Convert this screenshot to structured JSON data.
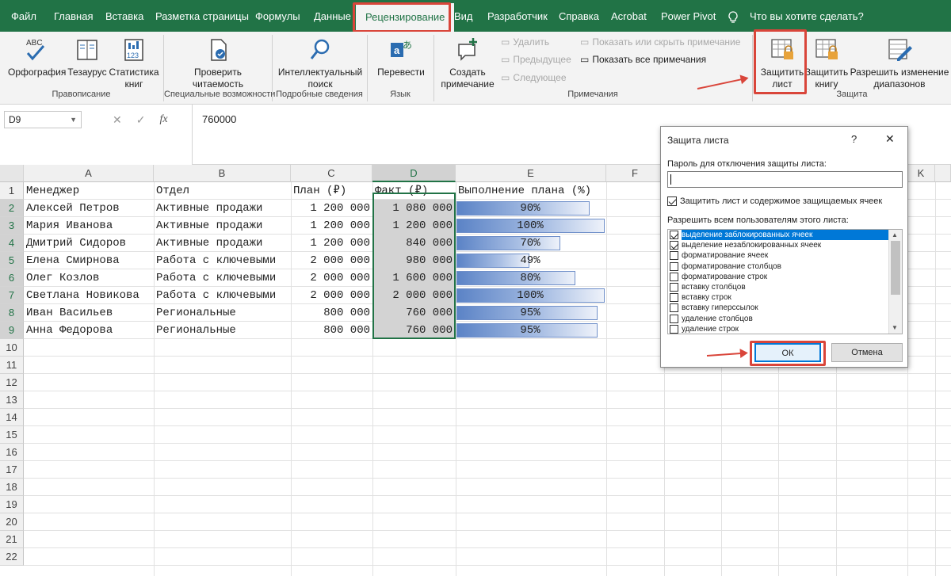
{
  "tabs": [
    "Файл",
    "Главная",
    "Вставка",
    "Разметка страницы",
    "Формулы",
    "Данные",
    "Рецензирование",
    "Вид",
    "Разработчик",
    "Справка",
    "Acrobat",
    "Power Pivot"
  ],
  "tell_me": "Что вы хотите сделать?",
  "ribbon": {
    "spelling": "Орфография",
    "thesaurus": "Тезаурус",
    "stats": [
      "Статистика",
      "книг"
    ],
    "group_proofing": "Правописание",
    "check_access": [
      "Проверить",
      "читаемость"
    ],
    "group_access": "Специальные возможности",
    "smart_lookup": [
      "Интеллектуальный",
      "поиск"
    ],
    "group_insights": "Подробные сведения",
    "translate": "Перевести",
    "group_lang": "Язык",
    "new_comment": [
      "Создать",
      "примечание"
    ],
    "delete": "Удалить",
    "previous": "Предыдущее",
    "next": "Следующее",
    "show_hide": "Показать или скрыть примечание",
    "show_all": "Показать все примечания",
    "group_comments": "Примечания",
    "protect_sheet": [
      "Защитить",
      "лист"
    ],
    "protect_book": [
      "Защитить",
      "книгу"
    ],
    "allow_edit": [
      "Разрешить изменение",
      "диапазонов"
    ],
    "group_protect": "Защита"
  },
  "formula_bar": {
    "name_box": "D9",
    "fx": "fx",
    "value": "760000"
  },
  "sheet": {
    "columns": [
      "A",
      "B",
      "C",
      "D",
      "E",
      "F",
      "",
      "K"
    ],
    "rows": [
      "1",
      "2",
      "3",
      "4",
      "5",
      "6",
      "7",
      "8",
      "9",
      "10",
      "11",
      "12",
      "13",
      "14",
      "15",
      "16",
      "17",
      "18",
      "19",
      "20",
      "21",
      "22"
    ],
    "headers": [
      "Менеджер",
      "Отдел",
      "План (₽)",
      "Факт (₽)",
      "Выполнение плана (%)"
    ],
    "data": [
      {
        "a": "Алексей Петров",
        "b": "Активные продажи",
        "c": "1 200 000",
        "d": "1 080 000",
        "e": "90%",
        "pct": 0.9
      },
      {
        "a": "Мария Иванова",
        "b": "Активные продажи",
        "c": "1 200 000",
        "d": "1 200 000",
        "e": "100%",
        "pct": 1.0
      },
      {
        "a": "Дмитрий Сидоров",
        "b": "Активные продажи",
        "c": "1 200 000",
        "d": "840 000",
        "e": "70%",
        "pct": 0.7
      },
      {
        "a": "Елена Смирнова",
        "b": "Работа с ключевыми",
        "c": "2 000 000",
        "d": "980 000",
        "e": "49%",
        "pct": 0.49
      },
      {
        "a": "Олег Козлов",
        "b": "Работа с ключевыми",
        "c": "2 000 000",
        "d": "1 600 000",
        "e": "80%",
        "pct": 0.8
      },
      {
        "a": "Светлана Новикова",
        "b": "Работа с ключевыми",
        "c": "2 000 000",
        "d": "2 000 000",
        "e": "100%",
        "pct": 1.0
      },
      {
        "a": "Иван Васильев",
        "b": "Региональные",
        "c": "800 000",
        "d": "760 000",
        "e": "95%",
        "pct": 0.95
      },
      {
        "a": "Анна Федорова",
        "b": "Региональные",
        "c": "800 000",
        "d": "760 000",
        "e": "95%",
        "pct": 0.95
      }
    ]
  },
  "dialog": {
    "title": "Защита листа",
    "help": "?",
    "close": "✕",
    "password_label": "Пароль для отключения защиты листа:",
    "protect_label": "Защитить лист и содержимое защищаемых ячеек",
    "allow_label": "Разрешить всем пользователям этого листа:",
    "options": [
      {
        "label": "выделение заблокированных ячеек",
        "checked": true
      },
      {
        "label": "выделение незаблокированных ячеек",
        "checked": true
      },
      {
        "label": "форматирование ячеек",
        "checked": false
      },
      {
        "label": "форматирование столбцов",
        "checked": false
      },
      {
        "label": "форматирование строк",
        "checked": false
      },
      {
        "label": "вставку столбцов",
        "checked": false
      },
      {
        "label": "вставку строк",
        "checked": false
      },
      {
        "label": "вставку гиперссылок",
        "checked": false
      },
      {
        "label": "удаление столбцов",
        "checked": false
      },
      {
        "label": "удаление строк",
        "checked": false
      }
    ],
    "ok": "ОК",
    "cancel": "Отмена"
  },
  "colors": {
    "excel_green": "#217346",
    "highlight_red": "#d9453a",
    "selection_blue": "#0078d7"
  }
}
